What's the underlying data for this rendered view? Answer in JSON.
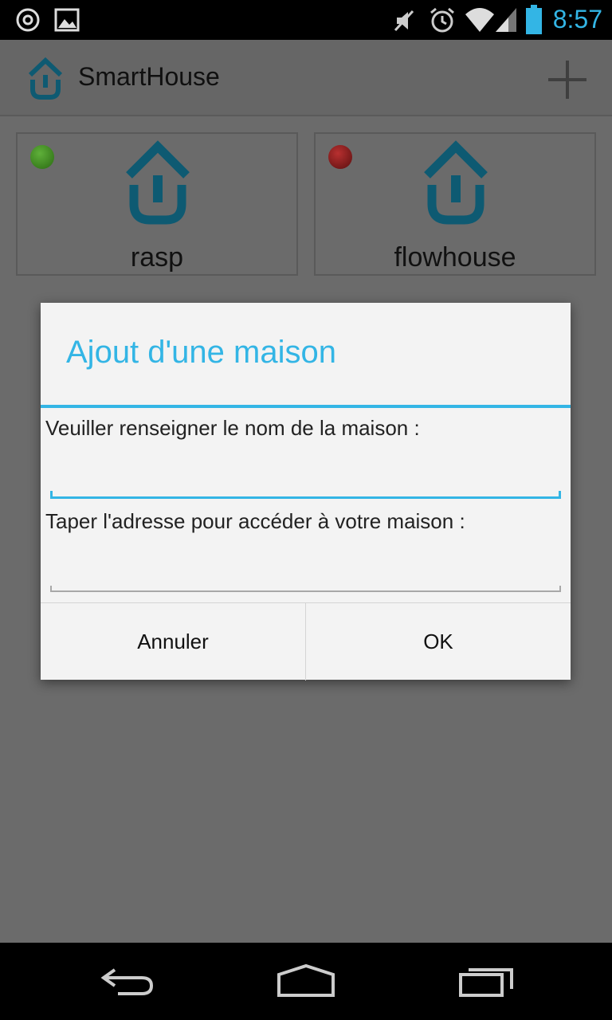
{
  "status_bar": {
    "time": "8:57",
    "icons": [
      "sync-icon",
      "image-icon",
      "mute-icon",
      "alarm-icon",
      "wifi-icon",
      "signal-icon",
      "battery-icon"
    ]
  },
  "action_bar": {
    "title": "SmartHouse",
    "add_icon": "plus-icon"
  },
  "houses": [
    {
      "name": "rasp",
      "status": "online",
      "status_color": "#3a8a1e"
    },
    {
      "name": "flowhouse",
      "status": "offline",
      "status_color": "#8a1a1a"
    }
  ],
  "dialog": {
    "title": "Ajout d'une maison",
    "name_label": "Veuiller renseigner le nom de la maison :",
    "name_value": "",
    "address_label": "Taper l'adresse pour accéder à votre maison :",
    "address_value": "",
    "cancel_label": "Annuler",
    "ok_label": "OK"
  },
  "nav_bar": {
    "icons": [
      "back-icon",
      "home-icon",
      "recents-icon"
    ]
  },
  "colors": {
    "accent": "#33b5e5",
    "logo": "#0e6a86"
  }
}
